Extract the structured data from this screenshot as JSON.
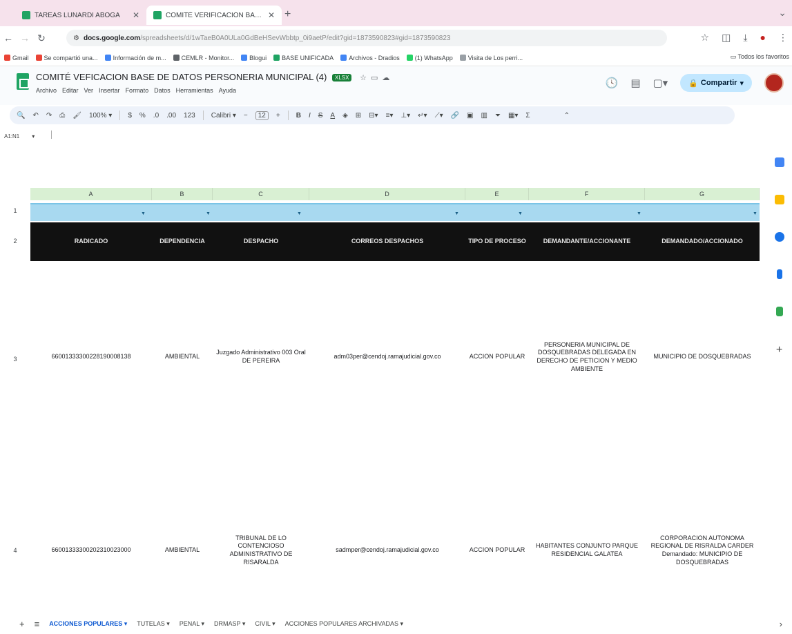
{
  "browser": {
    "tabs": [
      {
        "label": "TAREAS LUNARDI ABOGA",
        "active": false
      },
      {
        "label": "COMITÉ VERIFICACIÓN BASE",
        "active": true
      }
    ],
    "new_tab": "+",
    "url_domain": "docs.google.com",
    "url_path": "/spreadsheets/d/1wTaeB0A0ULa0GdBeHSevWbbtp_0i9aetP/edit?gid=1873590823#gid=1873590823",
    "bookmarks": [
      "Gmail",
      "Se compartió una...",
      "Información de m...",
      "CEMLR - Monitor...",
      "Blogui",
      "BASE UNIFICADA",
      "Archivos - Dradios",
      "(1) WhatsApp",
      "Visita de Los perri..."
    ],
    "all_bookmarks": "Todos los favoritos"
  },
  "sheets": {
    "title": "COMITÉ VEFICACION BASE DE DATOS PERSONERIA MUNICIPAL (4)",
    "badge": "XLSX",
    "menu": [
      "Archivo",
      "Editar",
      "Ver",
      "Insertar",
      "Formato",
      "Datos",
      "Herramientas",
      "Ayuda"
    ],
    "share_label": "Compartir",
    "zoom": "100%",
    "font": "Calibri",
    "font_size": "12",
    "name_box": "A1:N1",
    "columns": [
      "A",
      "B",
      "C",
      "D",
      "E",
      "F",
      "G"
    ],
    "headers": [
      "RADICADO",
      "DEPENDENCIA",
      "DESPACHO",
      "CORREOS DESPACHOS",
      "TIPO DE PROCESO",
      "DEMANDANTE/ACCIONANTE",
      "DEMANDADO/ACCIONADO"
    ],
    "row_numbers": [
      "1",
      "2",
      "3",
      "4"
    ],
    "rows": [
      [
        "66001333300228190008138",
        "AMBIENTAL",
        "Juzgado Administrativo 003 Oral DE PEREIRA",
        "adm03per@cendoj.ramajudicial.gov.co",
        "ACCION POPULAR",
        "PERSONERIA MUNICIPAL DE DOSQUEBRADAS DELEGADA EN DERECHO DE PETICION Y MEDIO AMBIENTE",
        "MUNICIPIO DE DOSQUEBRADAS"
      ],
      [
        "66001333300202310023000",
        "AMBIENTAL",
        "TRIBUNAL DE LO CONTENCIOSO ADMINISTRATIVO DE RISARALDA",
        "sadmper@cendoj.ramajudicial.gov.co",
        "ACCION POPULAR",
        "HABITANTES CONJUNTO PARQUE RESIDENCIAL GALATEA",
        "CORPORACION AUTONOMA REGIONAL DE RISRALDA CARDER Demandado: MUNICIPIO DE DOSQUEBRADAS"
      ]
    ],
    "sheet_tabs": [
      "ACCIONES POPULARES",
      "TUTELAS",
      "PENAL",
      "DRMASP",
      "CIVIL",
      "ACCIONES POPULARES ARCHIVADAS"
    ],
    "active_sheet": "ACCIONES POPULARES"
  }
}
